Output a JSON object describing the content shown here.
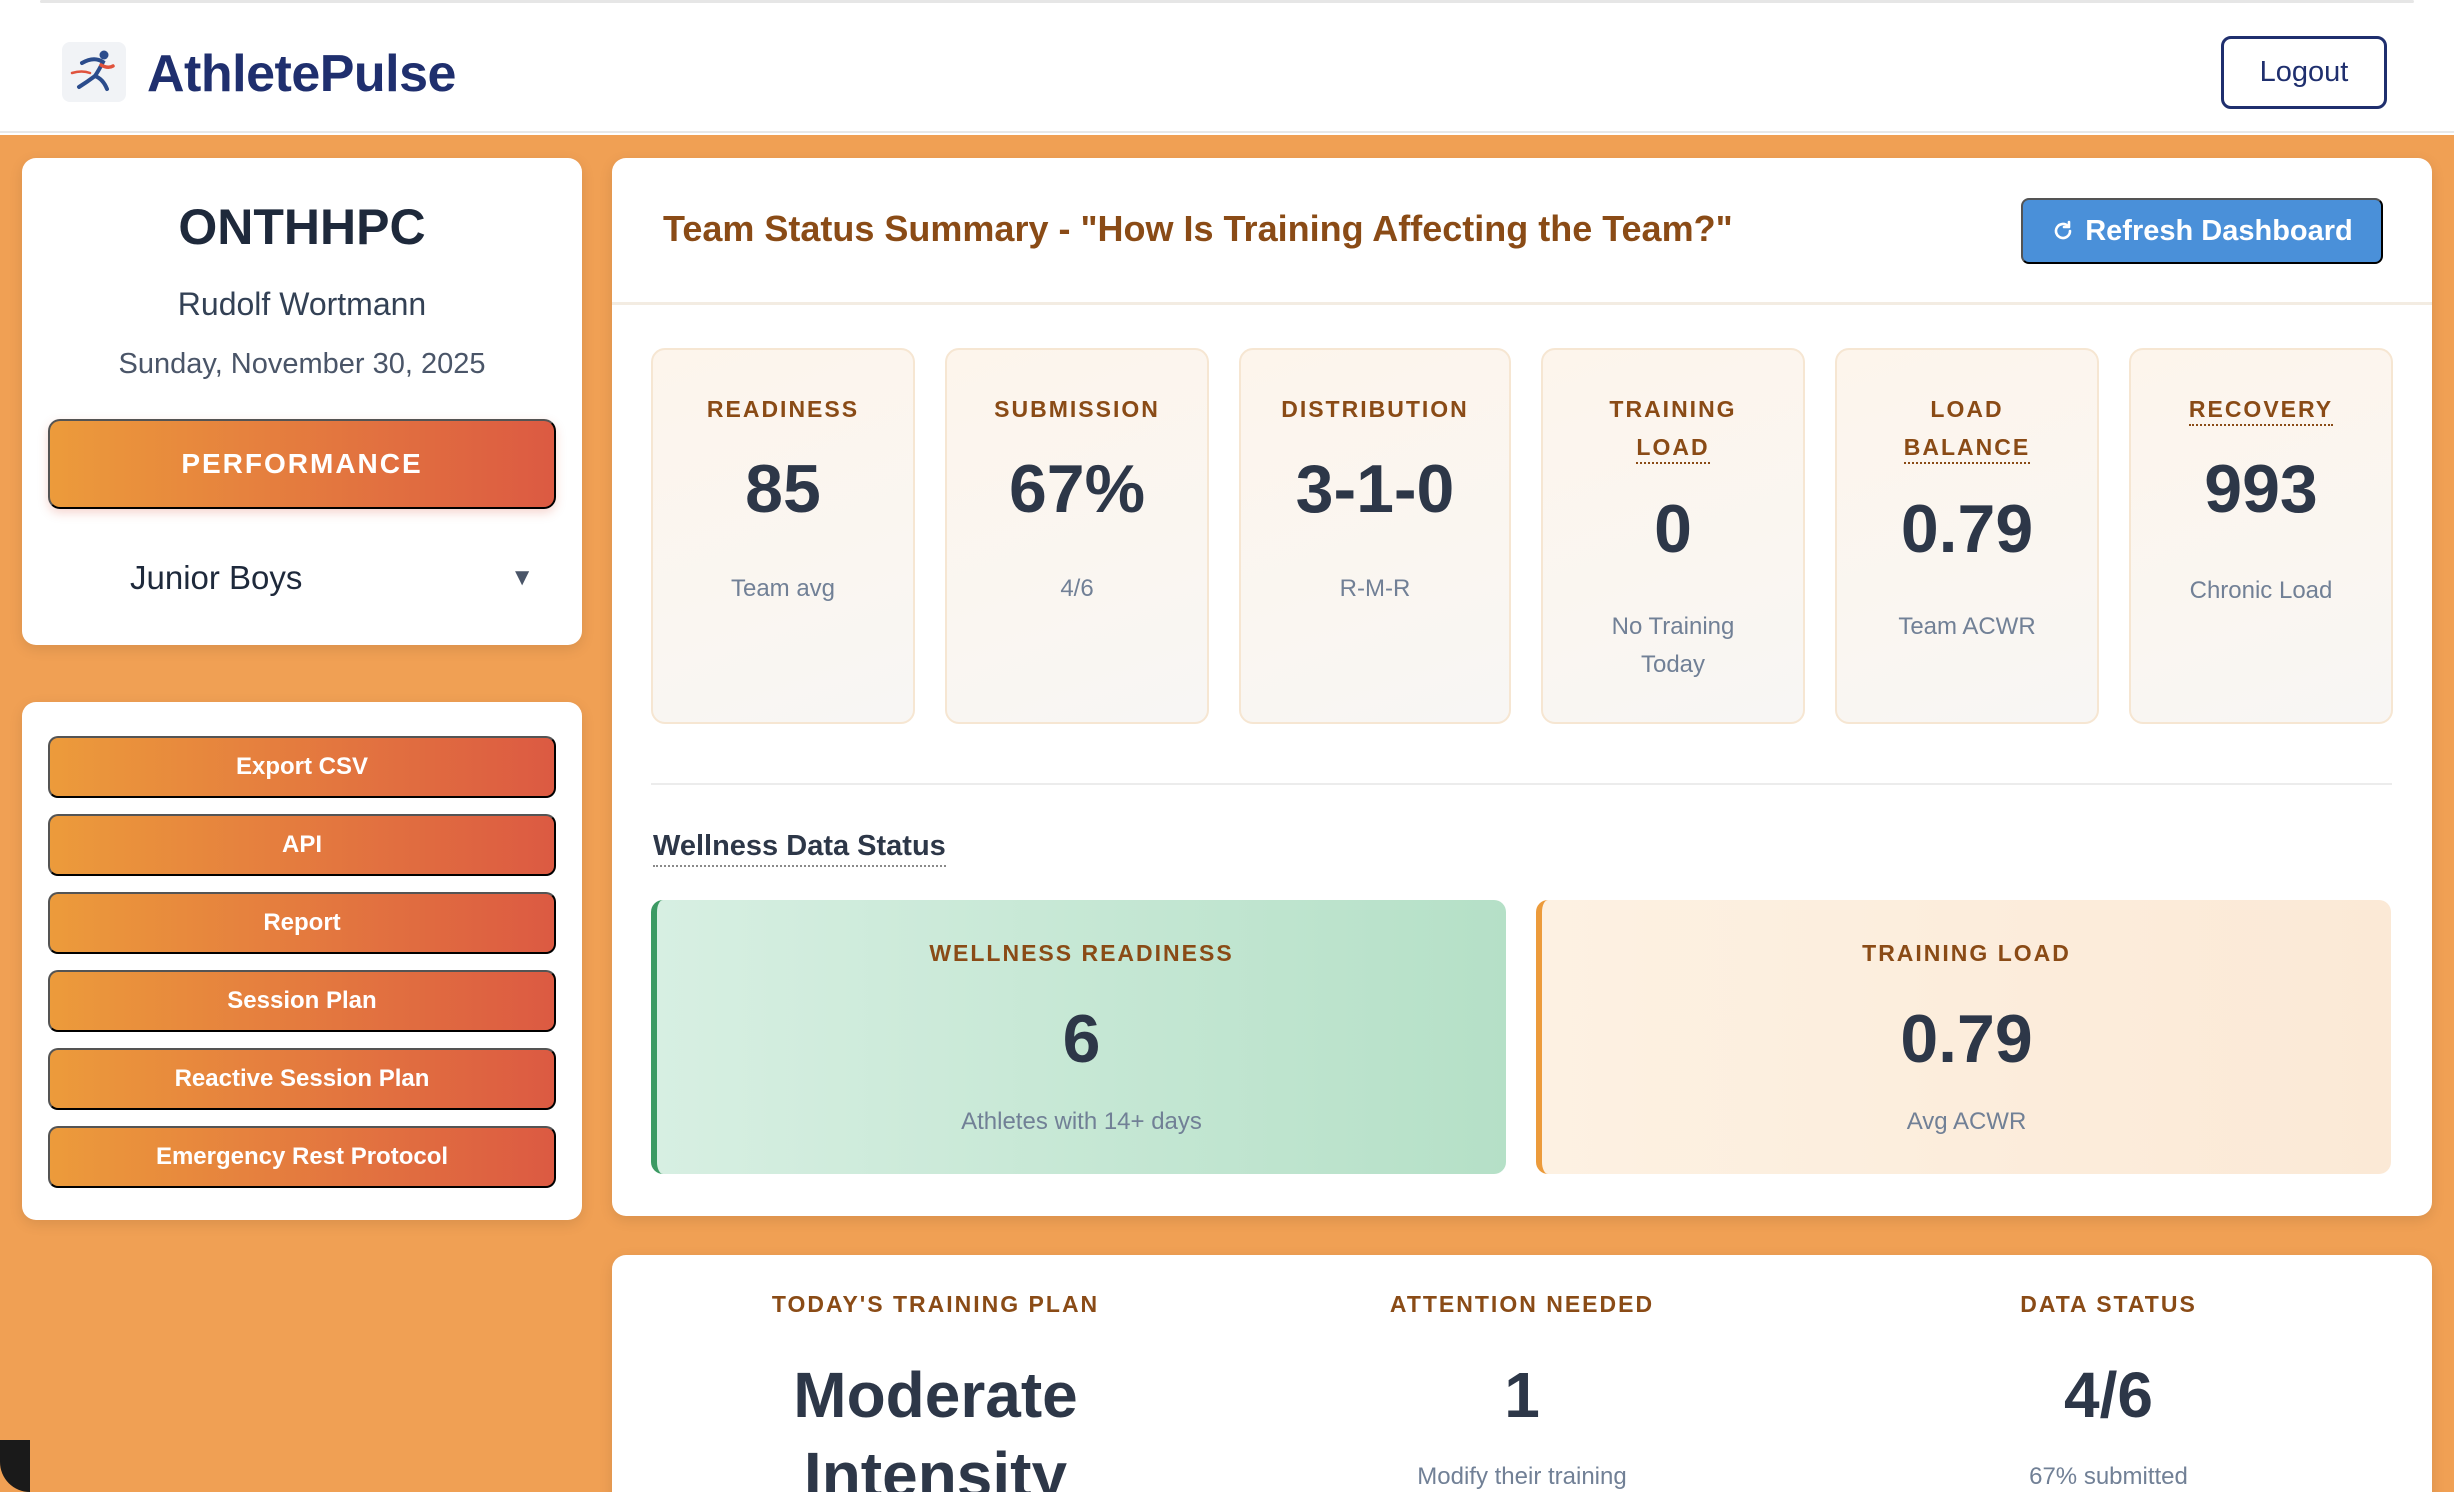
{
  "header": {
    "brand": "AthletePulse",
    "logout_label": "Logout"
  },
  "profile": {
    "organization": "ONTHHPC",
    "user_name": "Rudolf Wortmann",
    "date": "Sunday, November 30, 2025",
    "mode_button": "PERFORMANCE",
    "team_selected": "Junior Boys",
    "caret": "▼"
  },
  "actions": [
    {
      "label": "Export CSV"
    },
    {
      "label": "API"
    },
    {
      "label": "Report"
    },
    {
      "label": "Session Plan"
    },
    {
      "label": "Reactive Session Plan"
    },
    {
      "label": "Emergency Rest Protocol"
    }
  ],
  "summary": {
    "title": "Team Status Summary - \"How Is Training Affecting the Team?\"",
    "refresh_label": "Refresh Dashboard",
    "metrics": [
      {
        "label": "READINESS",
        "value": "85",
        "sub": "Team avg"
      },
      {
        "label": "SUBMISSION",
        "value": "67%",
        "sub": "4/6"
      },
      {
        "label": "DISTRIBUTION",
        "value": "3-1-0",
        "sub": "R-M-R"
      },
      {
        "label_line1": "TRAINING",
        "label_line2": "LOAD",
        "value": "0",
        "sub_line1": "No Training",
        "sub_line2": "Today"
      },
      {
        "label_line1": "LOAD",
        "label_line2": "BALANCE",
        "value": "0.79",
        "sub": "Team ACWR"
      },
      {
        "label": "RECOVERY",
        "value": "993",
        "sub": "Chronic Load"
      }
    ],
    "wellness_title": "Wellness Data Status",
    "wellness_panels": [
      {
        "label": "WELLNESS READINESS",
        "value": "6",
        "sub": "Athletes with 14+ days"
      },
      {
        "label": "TRAINING LOAD",
        "value": "0.79",
        "sub": "Avg ACWR"
      }
    ]
  },
  "bottom": {
    "columns": [
      {
        "label": "TODAY'S TRAINING PLAN",
        "value_line1": "Moderate",
        "value_line2": "Intensity"
      },
      {
        "label": "ATTENTION NEEDED",
        "value": "1",
        "sub": "Modify their training"
      },
      {
        "label": "DATA STATUS",
        "value": "4/6",
        "sub": "67% submitted"
      }
    ]
  },
  "colors": {
    "brand": "#1f2f6e",
    "accent_orange": "#f0a054",
    "button_gradient_start": "#ec9b3b",
    "button_gradient_end": "#dc5a42",
    "refresh_blue": "#4a90d9",
    "label_brown": "#8a4b16"
  }
}
